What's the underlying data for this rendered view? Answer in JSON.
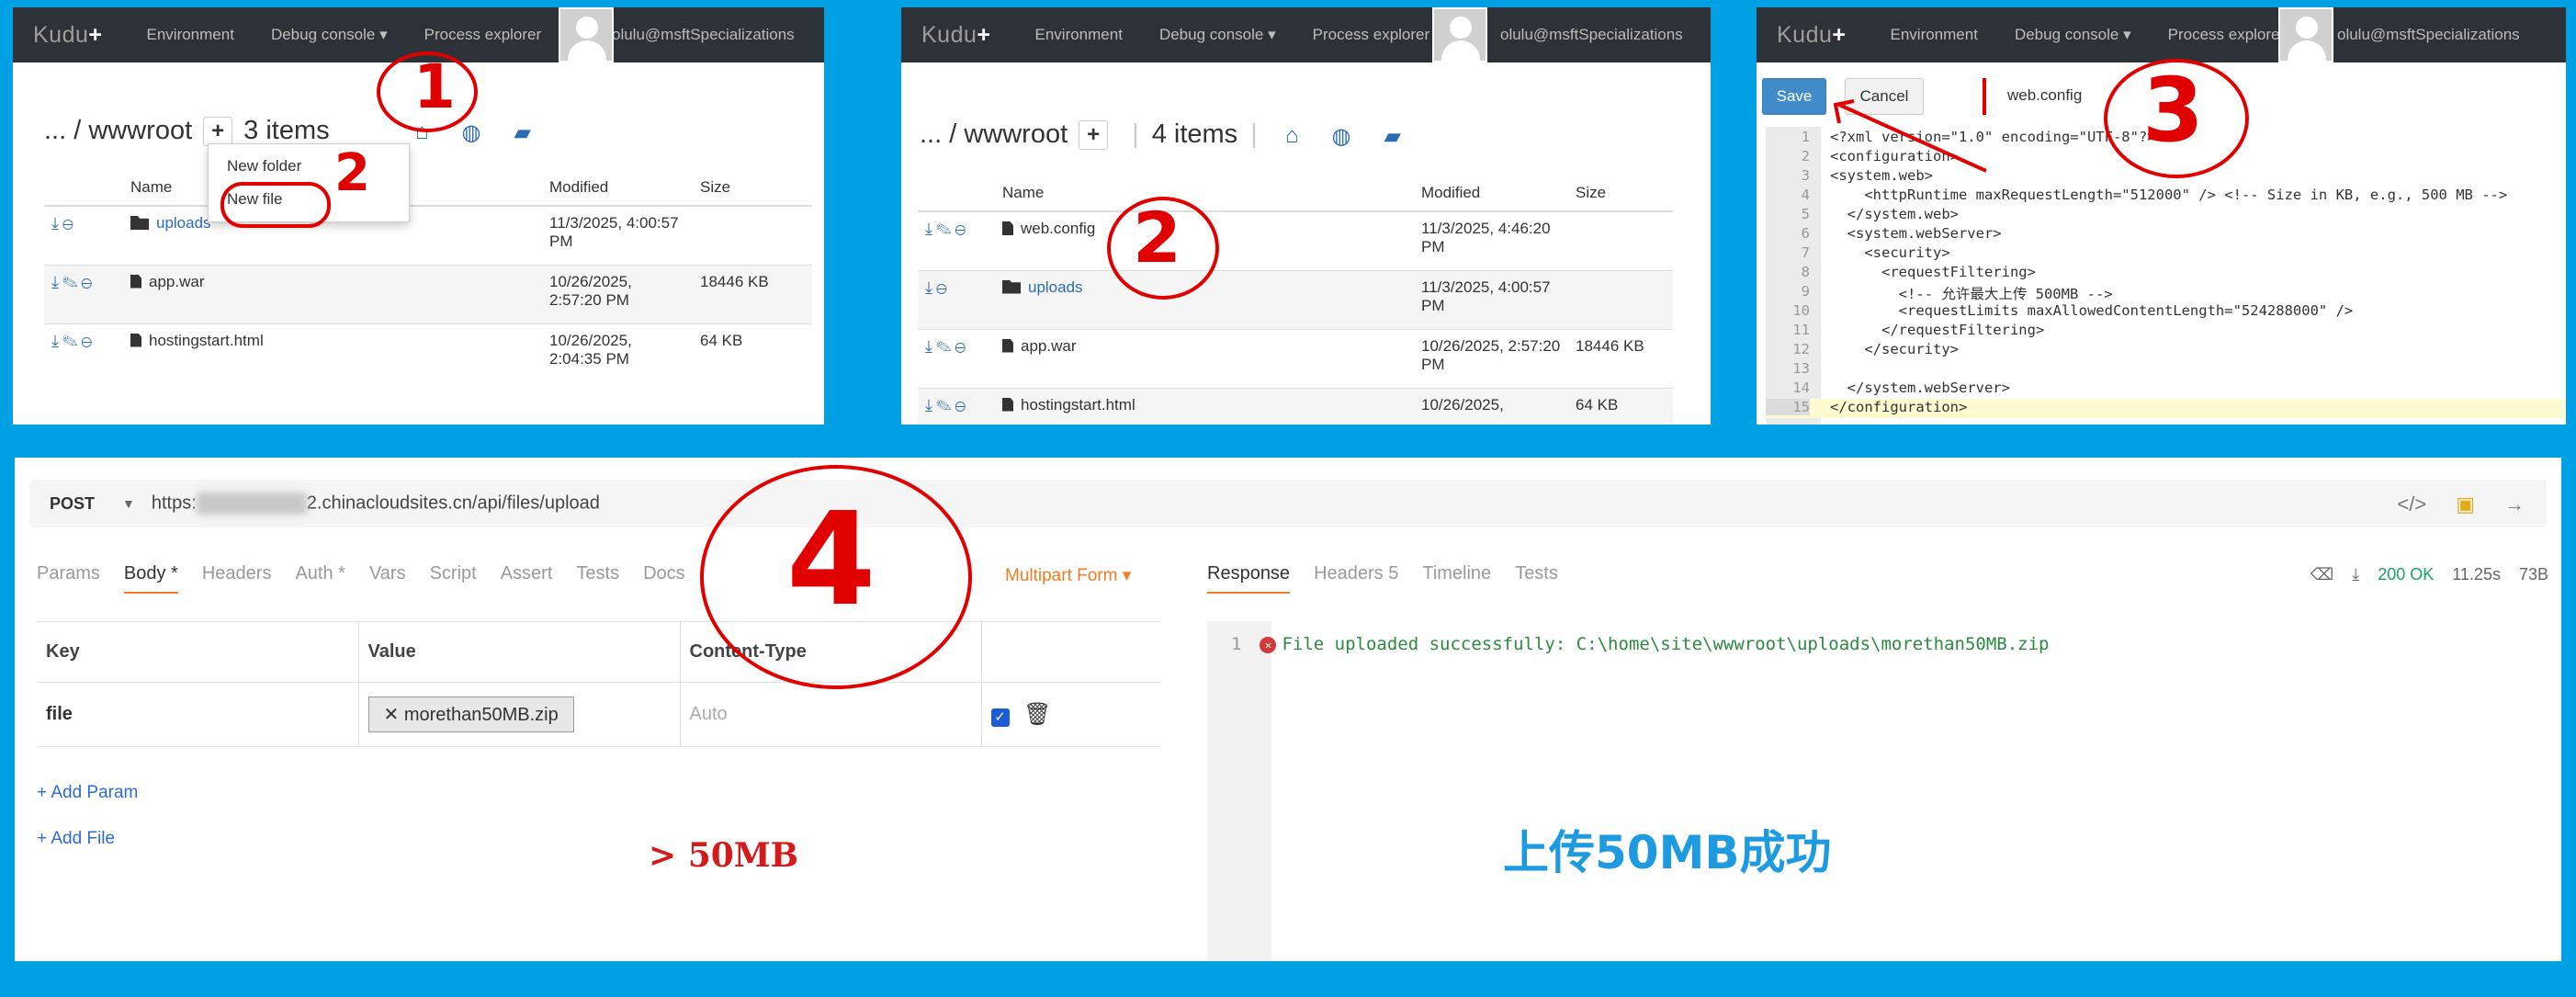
{
  "kudu": {
    "brand": "Kudu",
    "brand_plus": "+",
    "nav": [
      "Environment",
      "Debug console ▾",
      "Process explorer"
    ],
    "user": "olulu@msftSpecializations"
  },
  "panel1": {
    "crumb_root": "... / wwwroot",
    "plus": "+",
    "items_count": "3 items",
    "dropdown": [
      "New folder",
      "New file"
    ],
    "headers": [
      "Name",
      "Modified",
      "Size"
    ],
    "rows": [
      {
        "name": "uploads",
        "modified": "11/3/2025, 4:00:57 PM",
        "size": ""
      },
      {
        "name": "app.war",
        "modified": "10/26/2025, 2:57:20 PM",
        "size": "18446 KB"
      },
      {
        "name": "hostingstart.html",
        "modified": "10/26/2025, 2:04:35 PM",
        "size": "64 KB"
      }
    ],
    "annotation": "1",
    "annotation2": "2"
  },
  "panel2": {
    "crumb_root": "... / wwwroot",
    "plus": "+",
    "items_count": "4 items",
    "headers": [
      "Name",
      "Modified",
      "Size"
    ],
    "rows": [
      {
        "name": "web.config",
        "modified": "11/3/2025, 4:46:20 PM",
        "size": ""
      },
      {
        "name": "uploads",
        "modified": "11/3/2025, 4:00:57 PM",
        "size": ""
      },
      {
        "name": "app.war",
        "modified": "10/26/2025, 2:57:20 PM",
        "size": "18446 KB"
      },
      {
        "name": "hostingstart.html",
        "modified": "10/26/2025,",
        "size": "64 KB"
      }
    ],
    "annotation": "2"
  },
  "panel3": {
    "save": "Save",
    "cancel": "Cancel",
    "filename": "web.config",
    "annotation": "3",
    "lines": [
      "<?xml version=\"1.0\" encoding=\"UTF-8\"?>",
      "<configuration>",
      "<system.web>",
      "    <httpRuntime maxRequestLength=\"512000\" /> <!-- Size in KB, e.g., 500 MB -->",
      "  </system.web>",
      "  <system.webServer>",
      "    <security>",
      "      <requestFiltering>",
      "        <!-- 允许最大上传 500MB -->",
      "        <requestLimits maxAllowedContentLength=\"524288000\" />",
      "      </requestFiltering>",
      "    </security>",
      "",
      "  </system.webServer>",
      "</configuration>"
    ],
    "line_numbers": [
      "1",
      "2",
      "3",
      "4",
      "5",
      "6",
      "7",
      "8",
      "9",
      "10",
      "11",
      "12",
      "13",
      "14",
      "15"
    ]
  },
  "panel4": {
    "method": "POST",
    "url_prefix": "https:",
    "url_suffix": "2.chinacloudsites.cn/api/files/upload",
    "req_tabs": [
      "Params",
      "Body *",
      "Headers",
      "Auth *",
      "Vars",
      "Script",
      "Assert",
      "Tests",
      "Docs"
    ],
    "multipart": "Multipart Form ▾",
    "resp_tabs": [
      "Response",
      "Headers 5",
      "Timeline",
      "Tests"
    ],
    "status": "200 OK",
    "time": "11.25s",
    "size": "73B",
    "kv_headers": [
      "Key",
      "Value",
      "Content-Type"
    ],
    "kv_row": {
      "key": "file",
      "value": "morethan50MB.zip",
      "content_type": "Auto"
    },
    "add_param": "+ Add Param",
    "add_file": "+ Add File",
    "size_note": "> 50MB",
    "resp_line_no": "1",
    "resp_text": "File uploaded successfully: C:\\home\\site\\wwwroot\\uploads\\morethan50MB.zip",
    "success_note": "上传50MB成功",
    "annotation": "4"
  },
  "colors": {
    "accent": "#428bca",
    "annotation_red": "#e10000",
    "background": "#00a0e4",
    "success_blue": "#1e9ae0",
    "ok_green": "#1aa260"
  }
}
